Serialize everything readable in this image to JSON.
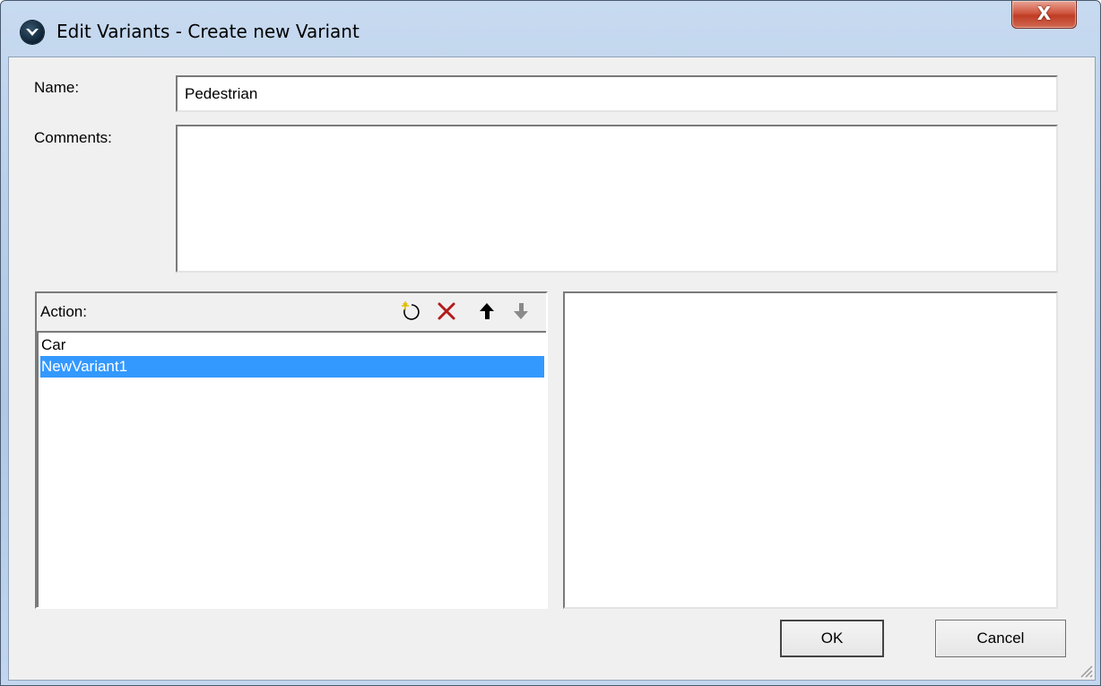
{
  "window": {
    "title": "Edit Variants - Create new Variant",
    "close_label": "X"
  },
  "form": {
    "name_label": "Name:",
    "name_value": "Pedestrian",
    "comments_label": "Comments:",
    "comments_value": ""
  },
  "action_list": {
    "header": "Action:",
    "toolbar": [
      "new-icon",
      "delete-icon",
      "move-up-icon",
      "move-down-icon"
    ],
    "items": [
      {
        "label": "Car",
        "selected": false
      },
      {
        "label": "NewVariant1",
        "selected": true
      }
    ]
  },
  "buttons": {
    "ok": "OK",
    "cancel": "Cancel"
  },
  "colors": {
    "selection": "#3399ff",
    "close_button": "#c94a33",
    "delete_icon": "#b31b1b"
  }
}
